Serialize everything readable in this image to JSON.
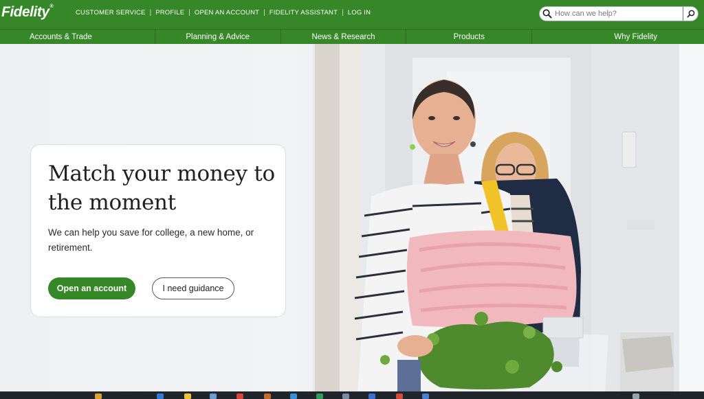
{
  "brand": {
    "logo_text": "Fidelity",
    "trademark": "®"
  },
  "utility_links": [
    {
      "label": "CUSTOMER SERVICE"
    },
    {
      "label": "PROFILE"
    },
    {
      "label": "OPEN AN ACCOUNT"
    },
    {
      "label": "FIDELITY ASSISTANT"
    },
    {
      "label": "LOG IN"
    }
  ],
  "search": {
    "placeholder": "How can we help?"
  },
  "nav": [
    {
      "label": "Accounts & Trade"
    },
    {
      "label": "Planning & Advice"
    },
    {
      "label": "News & Research"
    },
    {
      "label": "Products"
    },
    {
      "label": "Why Fidelity"
    }
  ],
  "hero": {
    "headline": "Match your money to the moment",
    "subtext": "We can help you save for college, a new home, or retirement.",
    "primary_button": "Open an account",
    "secondary_button": "I need guidance"
  },
  "colors": {
    "brand_green": "#368727",
    "text_dark": "#1f1f1f",
    "taskbar": "#20252b"
  },
  "icons": {
    "search": "search-icon",
    "submit": "search-submit-icon"
  }
}
